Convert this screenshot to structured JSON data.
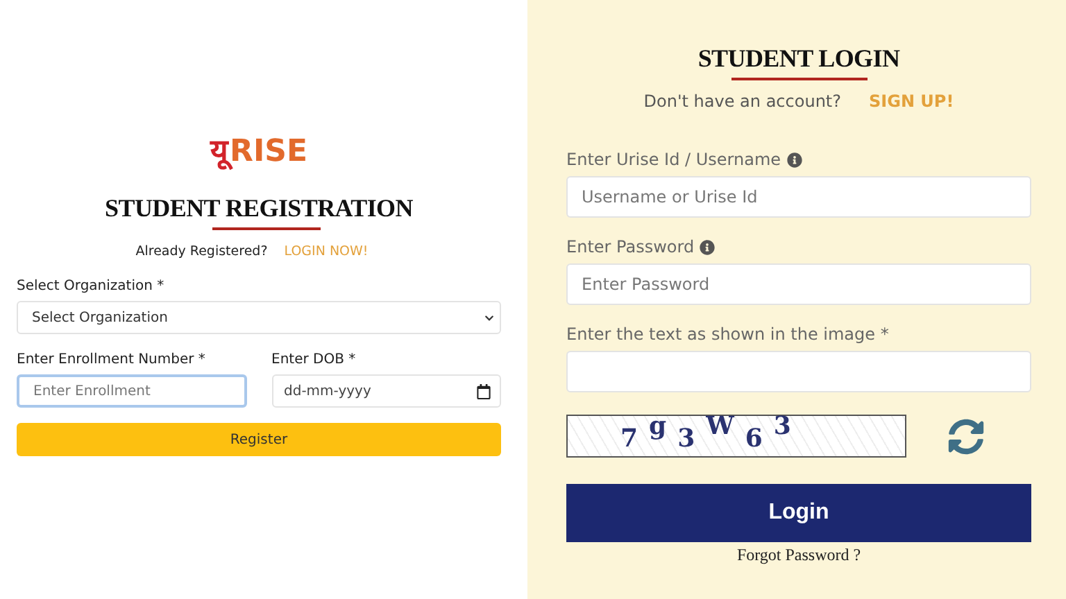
{
  "registration": {
    "logo": {
      "native": "यू",
      "latin": "RISE"
    },
    "title": "STUDENT REGISTRATION",
    "prompt": "Already Registered?",
    "link": "LOGIN NOW!",
    "organization": {
      "label": "Select Organization *",
      "value": "Select Organization"
    },
    "enrollment": {
      "label": "Enter Enrollment Number *",
      "placeholder": "Enter Enrollment",
      "focused": true
    },
    "dob": {
      "label": "Enter DOB *",
      "placeholder": "dd-mm-yyyy"
    },
    "button": "Register"
  },
  "login": {
    "title": "STUDENT LOGIN",
    "prompt": "Don't have an account?",
    "link": "SIGN UP!",
    "fields": [
      {
        "label": "Enter Urise Id / Username",
        "info": true,
        "placeholder": "Username or Urise Id"
      },
      {
        "label": "Enter Password",
        "info": true,
        "placeholder": "Enter Password"
      },
      {
        "label": "Enter the text as shown in the image *",
        "info": false
      }
    ],
    "captcha": [
      "7",
      "g",
      "3",
      "W",
      "6",
      "3"
    ],
    "button": "Login",
    "forgot": "Forgot Password ?"
  }
}
